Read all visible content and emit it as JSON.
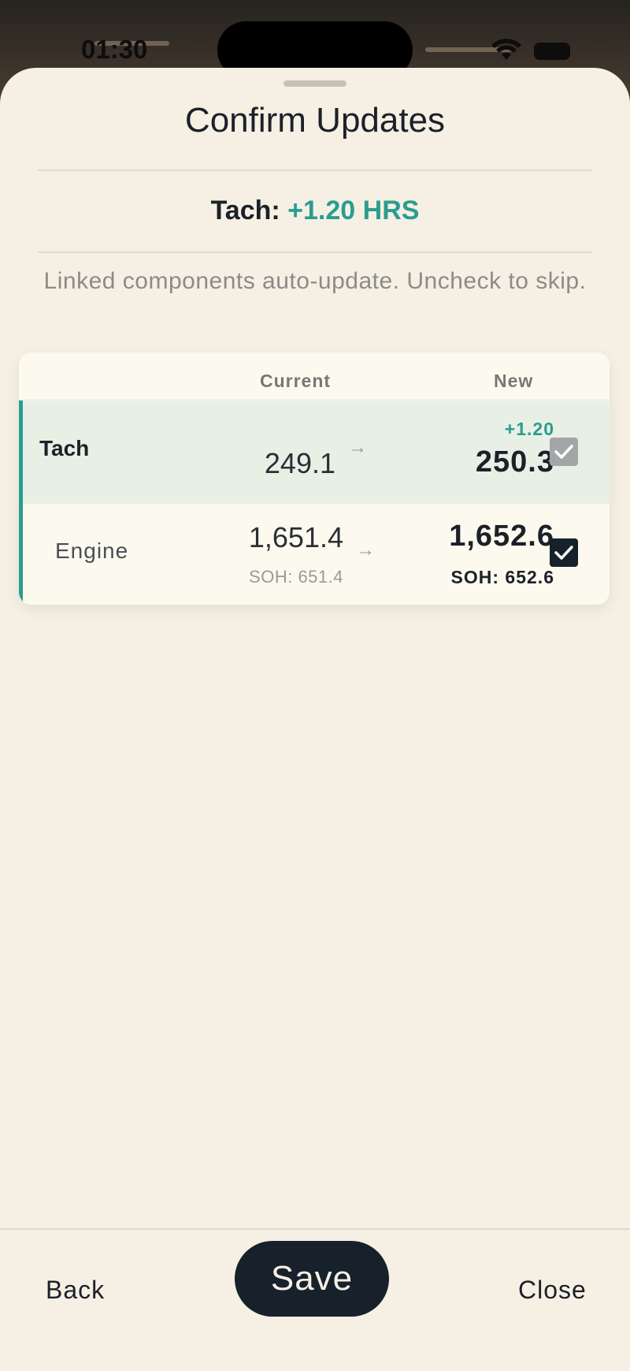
{
  "status_bar": {
    "time": "01:30"
  },
  "sheet": {
    "title": "Confirm Updates",
    "summary_label": "Tach:",
    "summary_delta": "+1.20 HRS",
    "hint": "Linked components auto-update. Uncheck to skip."
  },
  "table": {
    "headers": {
      "current": "Current",
      "new": "New"
    },
    "rows": [
      {
        "name": "Tach",
        "current": "249.1",
        "arrow": "→",
        "delta": "+1.20",
        "new": "250.3",
        "checked": true,
        "dimmed": true
      },
      {
        "name": "Engine",
        "current": "1,651.4",
        "current_sub": "SOH: 651.4",
        "arrow": "→",
        "new": "1,652.6",
        "new_sub": "SOH: 652.6",
        "checked": true,
        "dimmed": false
      }
    ]
  },
  "footer": {
    "back": "Back",
    "save": "Save",
    "close": "Close"
  },
  "colors": {
    "accent": "#2a9d8f",
    "dark": "#17212b",
    "sheet_bg": "#f6f0e4"
  },
  "icons": {
    "row_check": "checkmark-icon",
    "wifi": "wifi-icon",
    "battery": "battery-icon"
  }
}
